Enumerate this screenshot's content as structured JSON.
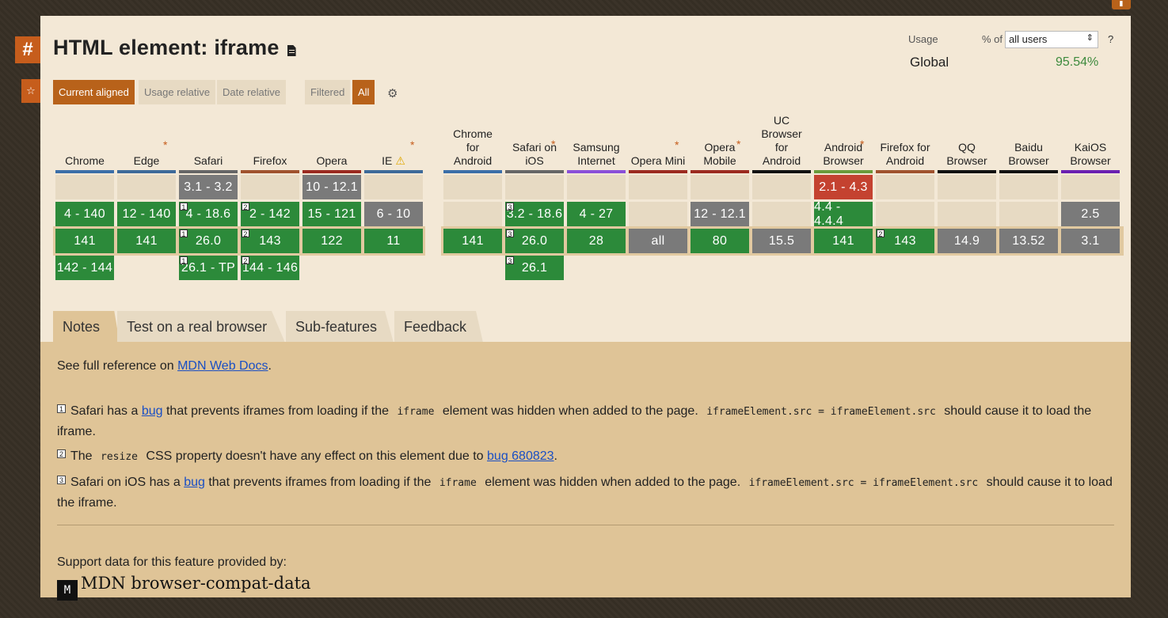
{
  "page": {
    "title": "HTML element: iframe",
    "usage_label": "Usage",
    "pct_of_label": "% of",
    "users_select": "all users",
    "help": "?",
    "global_label": "Global",
    "global_value": "95.54%"
  },
  "toggles": {
    "current_aligned": "Current aligned",
    "usage_relative": "Usage relative",
    "date_relative": "Date relative",
    "filtered": "Filtered",
    "all": "All"
  },
  "sidebar": {
    "hash": "#",
    "star": "☆"
  },
  "browsers": [
    {
      "name": "Chrome",
      "lines": [
        "Chrome"
      ],
      "ast": false,
      "color": "#3b6ea8"
    },
    {
      "name": "Edge",
      "lines": [
        "Edge"
      ],
      "ast": true,
      "color": "#3d6a99"
    },
    {
      "name": "Safari",
      "lines": [
        "Safari"
      ],
      "ast": false,
      "color": "#666666"
    },
    {
      "name": "Firefox",
      "lines": [
        "Firefox"
      ],
      "ast": false,
      "color": "#a0522d"
    },
    {
      "name": "Opera",
      "lines": [
        "Opera"
      ],
      "ast": false,
      "color": "#9b2a1f"
    },
    {
      "name": "IE",
      "lines": [
        "IE"
      ],
      "ast": true,
      "color": "#3d6a99"
    },
    {
      "name": "Chrome for Android",
      "lines": [
        "Chrome",
        "for",
        "Android"
      ],
      "ast": false,
      "color": "#3b6ea8"
    },
    {
      "name": "Safari on iOS",
      "lines": [
        "Safari on",
        "iOS"
      ],
      "ast": true,
      "color": "#666666"
    },
    {
      "name": "Samsung Internet",
      "lines": [
        "Samsung",
        "Internet"
      ],
      "ast": false,
      "color": "#8a4fd8"
    },
    {
      "name": "Opera Mini",
      "lines": [
        "Opera Mini"
      ],
      "ast": true,
      "color": "#9b2a1f"
    },
    {
      "name": "Opera Mobile",
      "lines": [
        "Opera",
        "Mobile"
      ],
      "ast": true,
      "color": "#9b2a1f"
    },
    {
      "name": "UC Browser for Android",
      "lines": [
        "UC",
        "Browser",
        "for",
        "Android"
      ],
      "ast": false,
      "color": "#111111"
    },
    {
      "name": "Android Browser",
      "lines": [
        "Android",
        "Browser"
      ],
      "ast": true,
      "color": "#6a9a3a"
    },
    {
      "name": "Firefox for Android",
      "lines": [
        "Firefox for",
        "Android"
      ],
      "ast": false,
      "color": "#a0522d"
    },
    {
      "name": "QQ Browser",
      "lines": [
        "QQ",
        "Browser"
      ],
      "ast": false,
      "color": "#111111"
    },
    {
      "name": "Baidu Browser",
      "lines": [
        "Baidu",
        "Browser"
      ],
      "ast": false,
      "color": "#111111"
    },
    {
      "name": "KaiOS Browser",
      "lines": [
        "KaiOS",
        "Browser"
      ],
      "ast": false,
      "color": "#6a1fb0"
    }
  ],
  "rows": [
    [
      {
        "t": "",
        "s": "empty"
      },
      {
        "t": "",
        "s": "empty"
      },
      {
        "t": "3.1 - 3.2",
        "s": "gray"
      },
      {
        "t": "",
        "s": "empty"
      },
      {
        "t": "10 - 12.1",
        "s": "gray"
      },
      {
        "t": "",
        "s": "empty"
      },
      {
        "t": "",
        "s": "empty"
      },
      {
        "t": "",
        "s": "empty"
      },
      {
        "t": "",
        "s": "empty"
      },
      {
        "t": "",
        "s": "empty"
      },
      {
        "t": "",
        "s": "empty"
      },
      {
        "t": "",
        "s": "empty"
      },
      {
        "t": "2.1 - 4.3",
        "s": "red"
      },
      {
        "t": "",
        "s": "empty"
      },
      {
        "t": "",
        "s": "empty"
      },
      {
        "t": "",
        "s": "empty"
      },
      {
        "t": "",
        "s": "empty"
      }
    ],
    [
      {
        "t": "4 - 140",
        "s": "green"
      },
      {
        "t": "12 - 140",
        "s": "green"
      },
      {
        "t": "4 - 18.6",
        "s": "green",
        "n": "1"
      },
      {
        "t": "2 - 142",
        "s": "green",
        "n": "2"
      },
      {
        "t": "15 - 121",
        "s": "green"
      },
      {
        "t": "6 - 10",
        "s": "gray"
      },
      {
        "t": "",
        "s": "empty"
      },
      {
        "t": "3.2 - 18.6",
        "s": "green",
        "n": "3"
      },
      {
        "t": "4 - 27",
        "s": "green"
      },
      {
        "t": "",
        "s": "empty"
      },
      {
        "t": "12 - 12.1",
        "s": "gray"
      },
      {
        "t": "",
        "s": "empty"
      },
      {
        "t": "4.4 - 4.4.4",
        "s": "green"
      },
      {
        "t": "",
        "s": "empty"
      },
      {
        "t": "",
        "s": "empty"
      },
      {
        "t": "",
        "s": "empty"
      },
      {
        "t": "2.5",
        "s": "gray"
      }
    ],
    [
      {
        "t": "141",
        "s": "green"
      },
      {
        "t": "141",
        "s": "green"
      },
      {
        "t": "26.0",
        "s": "green",
        "n": "1"
      },
      {
        "t": "143",
        "s": "green",
        "n": "2"
      },
      {
        "t": "122",
        "s": "green"
      },
      {
        "t": "11",
        "s": "green"
      },
      {
        "t": "141",
        "s": "green"
      },
      {
        "t": "26.0",
        "s": "green",
        "n": "3"
      },
      {
        "t": "28",
        "s": "green"
      },
      {
        "t": "all",
        "s": "gray"
      },
      {
        "t": "80",
        "s": "green"
      },
      {
        "t": "15.5",
        "s": "gray"
      },
      {
        "t": "141",
        "s": "green"
      },
      {
        "t": "143",
        "s": "green",
        "n": "2"
      },
      {
        "t": "14.9",
        "s": "gray"
      },
      {
        "t": "13.52",
        "s": "gray"
      },
      {
        "t": "3.1",
        "s": "gray"
      }
    ],
    [
      {
        "t": "142 - 144",
        "s": "green"
      },
      null,
      {
        "t": "26.1 - TP",
        "s": "green",
        "n": "1"
      },
      {
        "t": "144 - 146",
        "s": "green",
        "n": "2"
      },
      null,
      null,
      null,
      {
        "t": "26.1",
        "s": "green",
        "n": "3"
      },
      null,
      null,
      null,
      null,
      null,
      null,
      null,
      null,
      null
    ]
  ],
  "tabs": {
    "notes": "Notes",
    "test": "Test on a real browser",
    "subfeatures": "Sub-features",
    "feedback": "Feedback"
  },
  "notes": {
    "ref_prefix": "See full reference on ",
    "ref_link": "MDN Web Docs",
    "ref_suffix": ".",
    "n1_num": "1",
    "n1_a": "Safari has a ",
    "n1_link": "bug",
    "n1_b": " that prevents iframes from loading if the ",
    "n1_code1": "iframe",
    "n1_c": " element was hidden when added to the page. ",
    "n1_code2": "iframeElement.src = iframeElement.src",
    "n1_d": " should cause it to load the iframe.",
    "n2_num": "2",
    "n2_a": "The ",
    "n2_code": "resize",
    "n2_b": " CSS property doesn't have any effect on this element due to ",
    "n2_link": "bug 680823",
    "n2_c": ".",
    "n3_num": "3",
    "n3_a": "Safari on iOS has a ",
    "n3_link": "bug",
    "n3_b": " that prevents iframes from loading if the ",
    "n3_code1": "iframe",
    "n3_c": " element was hidden when added to the page. ",
    "n3_code2": "iframeElement.src = iframeElement.src",
    "n3_d": " should cause it to load the iframe.",
    "support_label": "Support data for this feature provided by:",
    "mdn_logo": "M",
    "mdn_name": "MDN browser-compat-data"
  },
  "colors": {
    "accent": "#b8621a",
    "supported": "#2c8a3a",
    "unknown": "#7a7a7a",
    "unsupported": "#c44230",
    "panel": "#f3e8d6",
    "notes_bg": "#dfc497"
  }
}
